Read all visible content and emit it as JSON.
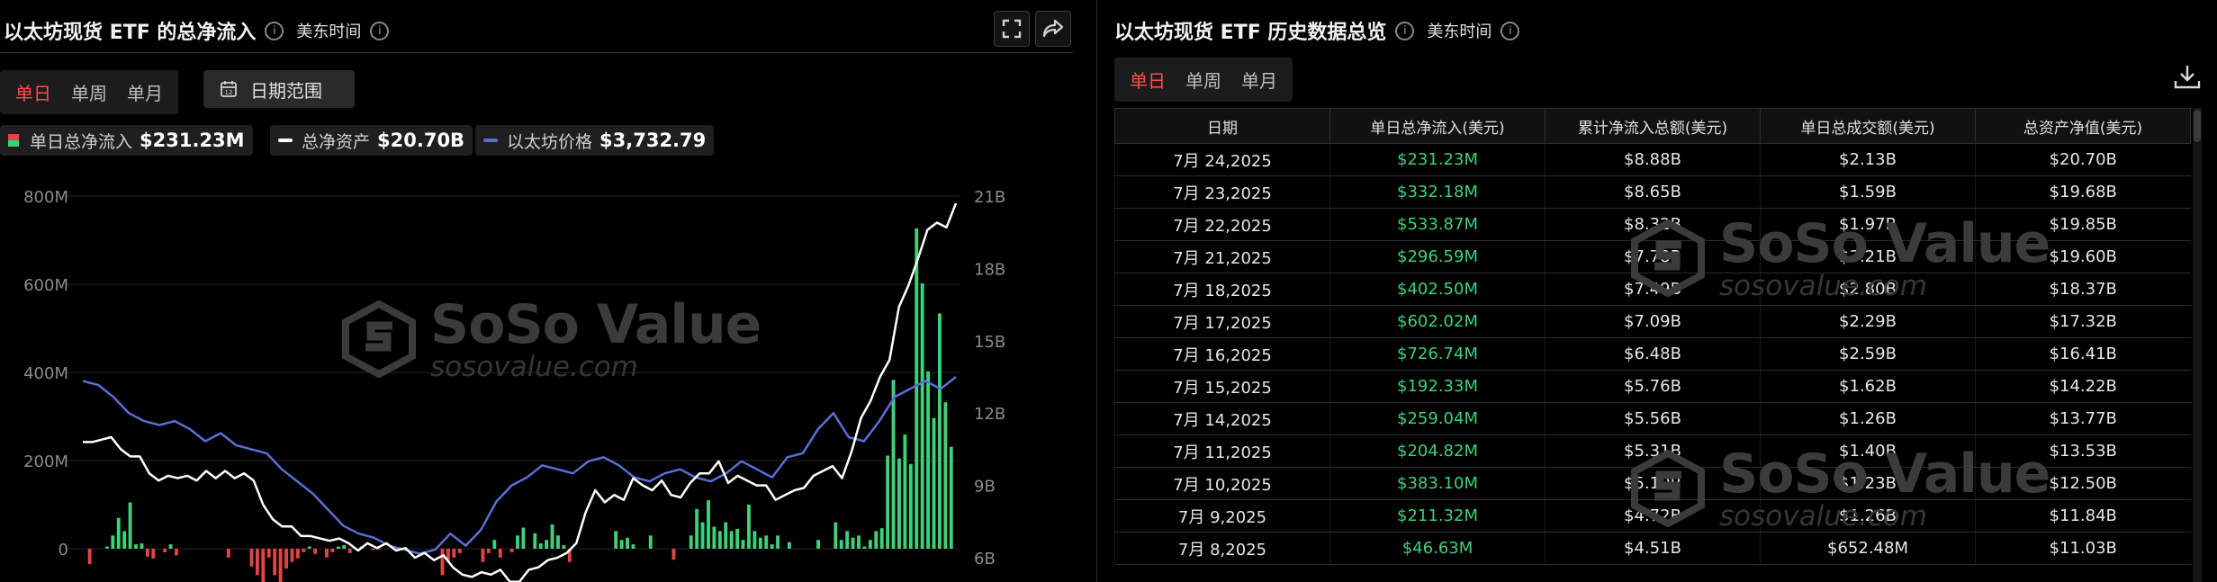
{
  "left": {
    "title": "以太坊现货 ETF 的总净流入",
    "info_icon": "info-icon",
    "timezone": "美东时间",
    "fullscreen_icon": "fullscreen-icon",
    "share_icon": "share-icon",
    "period_tabs": [
      "单日",
      "单周",
      "单月"
    ],
    "active_period": 0,
    "date_range_label": "日期范围",
    "calendar_icon": "calendar-icon",
    "legend": [
      {
        "label": "单日总净流入",
        "value": "$231.23M"
      },
      {
        "label": "总净资产",
        "value": "$20.70B"
      },
      {
        "label": "以太坊价格",
        "value": "$3,732.79"
      }
    ]
  },
  "watermark": {
    "brand": "SoSo Value",
    "site": "sosovalue.com"
  },
  "colors": {
    "inflow": "#3fd07a",
    "outflow": "#e24545",
    "assets_line": "#ffffff",
    "price_line": "#5a6fd6",
    "active_tab": "#ff4d4d",
    "background": "#000000"
  },
  "chart_data": {
    "type": "bar",
    "title": "以太坊现货 ETF 的总净流入",
    "left_axis": {
      "ticks": [
        "800M",
        "600M",
        "400M",
        "200M",
        "0"
      ],
      "range_musd": [
        -210,
        800
      ]
    },
    "right_axis": {
      "ticks": [
        "21B",
        "18B",
        "15B",
        "12B",
        "9B",
        "6B"
      ],
      "range_busd": [
        6,
        21
      ]
    },
    "grid": true,
    "legend_position": "top-left",
    "series": [
      {
        "name": "单日总净流入",
        "kind": "bar",
        "unit": "M USD",
        "values": [
          0,
          -35,
          0,
          0,
          5,
          30,
          70,
          40,
          105,
          10,
          12,
          -18,
          -22,
          0,
          -8,
          10,
          -15,
          0,
          0,
          0,
          0,
          0,
          0,
          0,
          0,
          -20,
          0,
          0,
          0,
          -40,
          -60,
          -80,
          -20,
          -60,
          -90,
          -45,
          -30,
          -22,
          -8,
          5,
          -12,
          0,
          -20,
          -8,
          5,
          8,
          -10,
          0,
          5,
          0,
          -3,
          -2,
          0,
          0,
          0,
          0,
          0,
          0,
          0,
          0,
          0,
          0,
          -60,
          -30,
          -20,
          -10,
          0,
          0,
          0,
          -30,
          -10,
          20,
          -20,
          0,
          -8,
          30,
          48,
          0,
          35,
          12,
          20,
          55,
          30,
          8,
          -30,
          0,
          0,
          0,
          0,
          0,
          0,
          0,
          40,
          20,
          25,
          10,
          0,
          0,
          30,
          0,
          0,
          0,
          -25,
          0,
          0,
          30,
          90,
          60,
          110,
          50,
          40,
          60,
          40,
          45,
          20,
          100,
          40,
          25,
          30,
          10,
          30,
          0,
          15,
          0,
          0,
          0,
          0,
          20,
          0,
          0,
          60,
          20,
          40,
          25,
          30,
          5,
          20,
          40,
          46.63,
          211.32,
          383.1,
          204.82,
          259.04,
          192.33,
          726.74,
          602.02,
          402.5,
          296.59,
          533.87,
          332.18,
          231.23
        ]
      },
      {
        "name": "总净资产",
        "kind": "line",
        "unit": "B USD",
        "values": [
          10.8,
          10.8,
          10.9,
          11.0,
          10.5,
          10.2,
          10.2,
          9.5,
          9.2,
          9.4,
          9.3,
          9.4,
          9.2,
          9.6,
          9.3,
          9.6,
          9.3,
          9.5,
          9.2,
          8.2,
          7.6,
          7.3,
          7.3,
          6.9,
          6.9,
          6.8,
          6.7,
          6.8,
          6.6,
          6.3,
          6.6,
          6.4,
          6.6,
          6.3,
          6.4,
          6.0,
          6.2,
          5.9,
          6.1,
          5.6,
          5.3,
          5.2,
          5.4,
          5.3,
          5.5,
          5.0,
          5.0,
          5.5,
          5.6,
          5.9,
          6.0,
          6.2,
          6.6,
          7.9,
          8.8,
          8.3,
          8.6,
          8.4,
          9.3,
          9.0,
          8.8,
          9.2,
          8.6,
          8.5,
          9.1,
          9.5,
          9.5,
          10.0,
          9.1,
          9.4,
          9.2,
          9.0,
          9.0,
          8.4,
          8.6,
          8.8,
          8.9,
          9.4,
          9.6,
          9.8,
          9.3,
          10.4,
          11.8,
          12.5,
          13.5,
          14.2,
          16.4,
          17.3,
          18.4,
          19.6,
          19.9,
          19.7,
          20.7
        ]
      },
      {
        "name": "以太坊价格",
        "kind": "line",
        "unit": "USD",
        "values": [
          3700,
          3650,
          3500,
          3300,
          3200,
          3150,
          3200,
          3100,
          2950,
          3050,
          2900,
          2850,
          2800,
          2600,
          2450,
          2300,
          2100,
          1900,
          1800,
          1750,
          1650,
          1600,
          1550,
          1600,
          1800,
          1650,
          1850,
          2200,
          2400,
          2500,
          2650,
          2600,
          2550,
          2700,
          2750,
          2650,
          2500,
          2450,
          2550,
          2600,
          2500,
          2450,
          2550,
          2700,
          2600,
          2500,
          2750,
          2800,
          3100,
          3300,
          3000,
          2950,
          3200,
          3500,
          3600,
          3700,
          3600,
          3750
        ]
      }
    ]
  },
  "right": {
    "title": "以太坊现货 ETF 历史数据总览",
    "info_icon": "info-icon",
    "timezone": "美东时间",
    "period_tabs": [
      "单日",
      "单周",
      "单月"
    ],
    "active_period": 0,
    "download_icon": "download-icon",
    "columns": [
      "日期",
      "单日总净流入(美元)",
      "累计净流入总额(美元)",
      "单日总成交额(美元)",
      "总资产净值(美元)"
    ],
    "rows": [
      [
        "7月 24,2025",
        "$231.23M",
        "$8.88B",
        "$2.13B",
        "$20.70B"
      ],
      [
        "7月 23,2025",
        "$332.18M",
        "$8.65B",
        "$1.59B",
        "$19.68B"
      ],
      [
        "7月 22,2025",
        "$533.87M",
        "$8.32B",
        "$1.97B",
        "$19.85B"
      ],
      [
        "7月 21,2025",
        "$296.59M",
        "$7.78B",
        "$3.21B",
        "$19.60B"
      ],
      [
        "7月 18,2025",
        "$402.50M",
        "$7.49B",
        "$2.80B",
        "$18.37B"
      ],
      [
        "7月 17,2025",
        "$602.02M",
        "$7.09B",
        "$2.29B",
        "$17.32B"
      ],
      [
        "7月 16,2025",
        "$726.74M",
        "$6.48B",
        "$2.59B",
        "$16.41B"
      ],
      [
        "7月 15,2025",
        "$192.33M",
        "$5.76B",
        "$1.62B",
        "$14.22B"
      ],
      [
        "7月 14,2025",
        "$259.04M",
        "$5.56B",
        "$1.26B",
        "$13.77B"
      ],
      [
        "7月 11,2025",
        "$204.82M",
        "$5.31B",
        "$1.40B",
        "$13.53B"
      ],
      [
        "7月 10,2025",
        "$383.10M",
        "$5.10B",
        "$1.23B",
        "$12.50B"
      ],
      [
        "7月 9,2025",
        "$211.32M",
        "$4.72B",
        "$1.26B",
        "$11.84B"
      ],
      [
        "7月 8,2025",
        "$46.63M",
        "$4.51B",
        "$652.48M",
        "$11.03B"
      ]
    ]
  }
}
